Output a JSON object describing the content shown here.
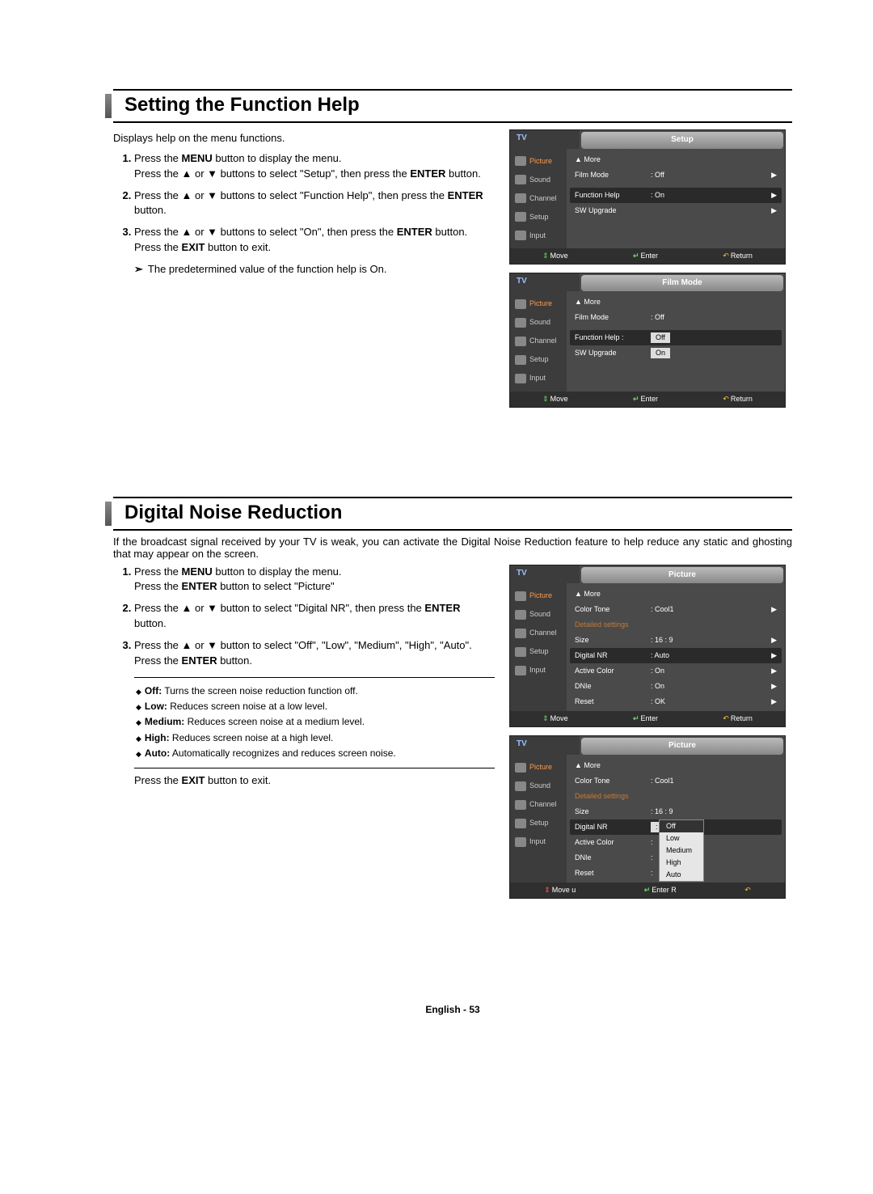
{
  "section1": {
    "title": "Setting the Function Help",
    "intro": "Displays help on the menu functions.",
    "steps": [
      "Press the <strong>MENU</strong> button to display the menu.<br>Press the ▲ or ▼ buttons to select \"Setup\", then press the <strong>ENTER</strong> button.",
      "Press the ▲ or ▼ buttons to select \"Function Help\", then press the <strong>ENTER</strong> button.",
      "Press the ▲ or ▼ buttons to select \"On\", then press the <strong>ENTER</strong> button.<br>Press the <strong>EXIT</strong> button to exit."
    ],
    "note": "The predetermined value of the function help is On."
  },
  "osd1": {
    "tv": "TV",
    "title": "Setup",
    "side": [
      "Picture",
      "Sound",
      "Channel",
      "Setup",
      "Input"
    ],
    "rows": [
      {
        "label": "▲ More",
        "val": ""
      },
      {
        "label": "Film Mode",
        "val": ": Off",
        "arrow": true
      },
      {
        "label": "",
        "val": "",
        "detailed": true
      },
      {
        "label": "Function Help",
        "val": ": On",
        "hl": true,
        "arrow": true
      },
      {
        "label": "SW Upgrade",
        "val": "",
        "arrow": true
      }
    ],
    "footer": {
      "move": "Move",
      "enter": "Enter",
      "ret": "Return"
    }
  },
  "osd2": {
    "tv": "TV",
    "title": "Film Mode",
    "side": [
      "Picture",
      "Sound",
      "Channel",
      "Setup",
      "Input"
    ],
    "rows": [
      {
        "label": "▲ More",
        "val": ""
      },
      {
        "label": "Film Mode",
        "val": ": Off"
      },
      {
        "label": "",
        "val": "",
        "detailed": true
      },
      {
        "label": "Function Help :",
        "val": "Off",
        "box": true,
        "hl": true
      },
      {
        "label": "SW Upgrade",
        "val": "On",
        "box": true
      }
    ],
    "footer": {
      "move": "Move",
      "enter": "Enter",
      "ret": "Return"
    }
  },
  "section2": {
    "title": "Digital Noise Reduction",
    "intro": "If the broadcast signal received by your TV is weak, you can activate the Digital Noise Reduction feature to help reduce any static and ghosting that may appear on the screen.",
    "steps": [
      "Press the <strong>MENU</strong> button to display the menu.<br>Press the <strong>ENTER</strong> button to select \"Picture\"",
      "Press the ▲ or ▼ button to select \"Digital NR\", then press the <strong>ENTER</strong> button.",
      "Press the ▲ or ▼ button to select \"Off\", \"Low\", \"Medium\", \"High\", \"Auto\".<br>Press the <strong>ENTER</strong> button."
    ],
    "opts": [
      {
        "name": "Off:",
        "desc": "Turns the screen noise reduction function off."
      },
      {
        "name": "Low:",
        "desc": "Reduces screen noise at a low level."
      },
      {
        "name": "Medium:",
        "desc": "Reduces screen noise at a medium level."
      },
      {
        "name": "High:",
        "desc": "Reduces screen noise at a high level."
      },
      {
        "name": "Auto:",
        "desc": "Automatically recognizes and reduces screen noise."
      }
    ],
    "exit": "Press the <strong>EXIT</strong> button to exit."
  },
  "osd3": {
    "tv": "TV",
    "title": "Picture",
    "side": [
      "Picture",
      "Sound",
      "Channel",
      "Setup",
      "Input"
    ],
    "rows": [
      {
        "label": "▲ More",
        "val": ""
      },
      {
        "label": "Color Tone",
        "val": ": Cool1",
        "arrow": true
      },
      {
        "label": "Detailed settings",
        "val": "",
        "detailed": true
      },
      {
        "label": "Size",
        "val": ": 16 : 9",
        "arrow": true
      },
      {
        "label": "Digital NR",
        "val": ": Auto",
        "hl": true,
        "arrow": true
      },
      {
        "label": "Active Color",
        "val": ": On",
        "arrow": true
      },
      {
        "label": "DNIe",
        "val": ": On",
        "arrow": true
      },
      {
        "label": "Reset",
        "val": ": OK",
        "arrow": true
      }
    ],
    "footer": {
      "move": "Move",
      "enter": "Enter",
      "ret": "Return"
    }
  },
  "osd4": {
    "tv": "TV",
    "title": "Picture",
    "side": [
      "Picture",
      "Sound",
      "Channel",
      "Setup",
      "Input"
    ],
    "rows": [
      {
        "label": "▲ More",
        "val": ""
      },
      {
        "label": "Color Tone",
        "val": ": Cool1"
      },
      {
        "label": "Detailed settings",
        "val": "",
        "detailed": true
      },
      {
        "label": "Size",
        "val": ": 16 : 9"
      },
      {
        "label": "Digital NR",
        "val": ": Off",
        "box": true,
        "hl": true,
        "dropdown": [
          "Off",
          "Low",
          "Medium",
          "High",
          "Auto"
        ]
      },
      {
        "label": "Active Color",
        "val": ":"
      },
      {
        "label": "DNIe",
        "val": ":"
      },
      {
        "label": "Reset",
        "val": ":"
      }
    ],
    "footer": {
      "move": "Move   u",
      "enter": "Enter   R",
      "ret": ""
    },
    "footerStyle": "red"
  },
  "footer": "English - 53"
}
